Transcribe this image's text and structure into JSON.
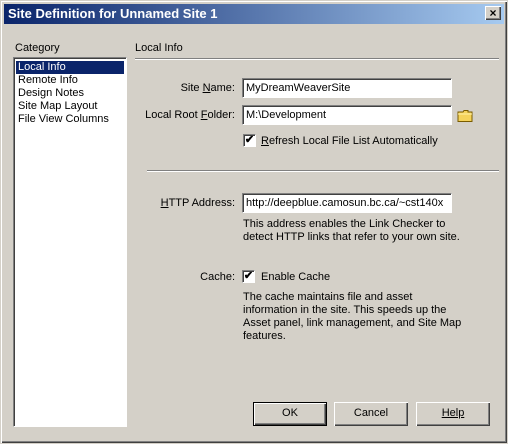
{
  "window": {
    "title": "Site Definition for Unnamed Site 1",
    "close_glyph": "×"
  },
  "category": {
    "label": "Category",
    "items": [
      "Local Info",
      "Remote Info",
      "Design Notes",
      "Site Map Layout",
      "File View Columns"
    ],
    "selected": "Local Info"
  },
  "panel": {
    "title": "Local Info"
  },
  "site_name": {
    "label_pre": "Site ",
    "label_key": "N",
    "label_post": "ame:",
    "value": "MyDreamWeaverSite"
  },
  "local_root": {
    "label_pre": "Local Root ",
    "label_key": "F",
    "label_post": "older:",
    "value": "M:\\Development",
    "icon": "folder-icon"
  },
  "refresh": {
    "checked": true,
    "label_key": "R",
    "label_post": "efresh Local File List Automatically"
  },
  "http": {
    "label_pre": "",
    "label_key": "H",
    "label_post": "TTP Address:",
    "value": "http://deepblue.camosun.bc.ca/~cst140x",
    "help": "This address enables the Link Checker to detect HTTP links that refer to your own site."
  },
  "cache": {
    "label": "Cache:",
    "checked": true,
    "checkbox_label": "Enable Cache",
    "help": "The cache maintains file and asset information in the site.  This speeds up the Asset panel, link management, and Site Map features."
  },
  "buttons": {
    "ok": "OK",
    "cancel": "Cancel",
    "help": "Help"
  },
  "colors": {
    "face": "#d4d0c8",
    "title_start": "#0a246a",
    "title_end": "#a6caf0",
    "selection": "#0a246a"
  }
}
